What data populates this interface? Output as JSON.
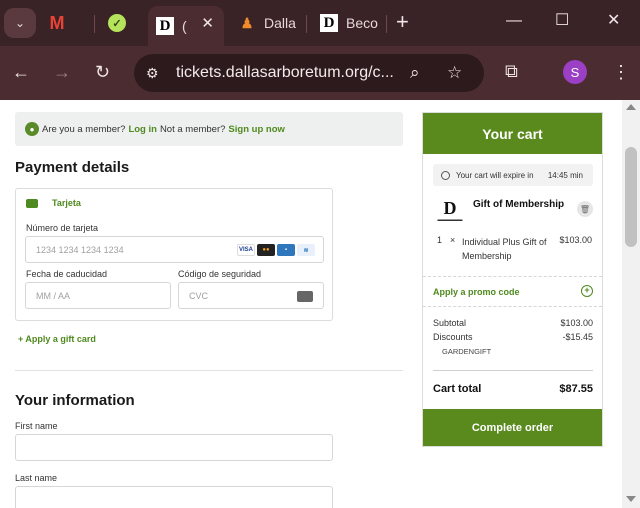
{
  "browser": {
    "tabs": [
      {
        "title": "",
        "favicon": "gmail-icon"
      },
      {
        "title": "",
        "favicon": "green-circle-icon"
      },
      {
        "title": "(",
        "favicon": "dallas-arboretum-icon"
      },
      {
        "title": "Dalla",
        "favicon": "orange-figure-icon"
      },
      {
        "title": "Beco",
        "favicon": "dallas-arboretum-icon"
      }
    ],
    "url": "tickets.dallasarboretum.org/c...",
    "profile_initial": "S"
  },
  "banner": {
    "question": "Are you a member?",
    "login": "Log in",
    "not_member": "Not a member?",
    "signup": "Sign up now"
  },
  "payment": {
    "title": "Payment details",
    "method": "Tarjeta",
    "card_number_label": "Número de tarjeta",
    "card_number_placeholder": "1234 1234 1234 1234",
    "expiry_label": "Fecha de caducidad",
    "expiry_placeholder": "MM / AA",
    "cvc_label": "Código de seguridad",
    "cvc_placeholder": "CVC",
    "brands": [
      "VISA",
      "MC",
      "AMEX",
      ""
    ],
    "gift_card": "+ Apply a gift card"
  },
  "info": {
    "title": "Your information",
    "first_name_label": "First name",
    "last_name_label": "Last name"
  },
  "cart": {
    "title": "Your cart",
    "expire_text": "Your cart will expire in",
    "expire_time": "14:45 min",
    "item_name": "Gift of Membership",
    "line_qty": "1",
    "line_x": "×",
    "line_desc": "Individual Plus Gift of Membership",
    "line_price": "$103.00",
    "promo": "Apply a promo code",
    "subtotal_label": "Subtotal",
    "subtotal_value": "$103.00",
    "discounts_label": "Discounts",
    "discounts_value": "-$15.45",
    "promo_code": "GARDENGIFT",
    "total_label": "Cart total",
    "total_value": "$87.55",
    "complete_button": "Complete order"
  }
}
